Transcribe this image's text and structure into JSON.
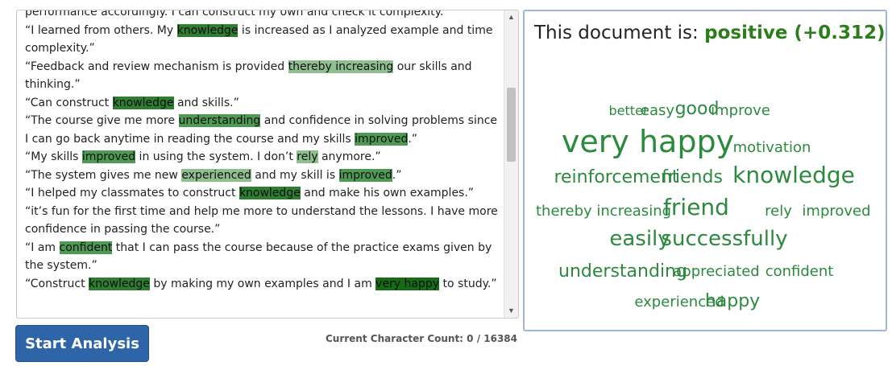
{
  "editor": {
    "lines": [
      [
        {
          "t": "performance accordingly. I can construct my own and check it complexity.”"
        }
      ],
      [
        {
          "t": "“I learned from others. My "
        },
        {
          "t": "knowledge",
          "h": "dark"
        },
        {
          "t": " is increased as I analyzed example and time complexity.”"
        }
      ],
      [
        {
          "t": "“Feedback and review mechanism is provided "
        },
        {
          "t": "thereby increasing",
          "h": "light"
        },
        {
          "t": " our skills and thinking.”"
        }
      ],
      [
        {
          "t": "“Can construct "
        },
        {
          "t": "knowledge",
          "h": "dark"
        },
        {
          "t": " and skills.”"
        }
      ],
      [
        {
          "t": "“The course give me more "
        },
        {
          "t": "understanding",
          "h": "mid"
        },
        {
          "t": " and confidence in solving problems since I can go back anytime in reading the course and my skills "
        },
        {
          "t": "improved",
          "h": "mid"
        },
        {
          "t": ".”"
        }
      ],
      [
        {
          "t": "“My skills "
        },
        {
          "t": "improved",
          "h": "mid"
        },
        {
          "t": " in using the system. I don’t "
        },
        {
          "t": "rely",
          "h": "light"
        },
        {
          "t": " anymore.”"
        }
      ],
      [
        {
          "t": "“The system gives me new "
        },
        {
          "t": "experienced",
          "h": "light"
        },
        {
          "t": " and my skill is "
        },
        {
          "t": "improved",
          "h": "mid"
        },
        {
          "t": ".”"
        }
      ],
      [
        {
          "t": "“I helped my classmates to construct "
        },
        {
          "t": "knowledge",
          "h": "dark"
        },
        {
          "t": " and make his own examples.”"
        }
      ],
      [
        {
          "t": "“it’s fun for the first time and help me more to understand the lessons. I have more confidence in passing the course.”"
        }
      ],
      [
        {
          "t": "“I am "
        },
        {
          "t": "confident",
          "h": "mid"
        },
        {
          "t": " that I can pass the course because of the practice exams given by the system.”"
        }
      ],
      [
        {
          "t": "“Construct "
        },
        {
          "t": "knowledge",
          "h": "dark"
        },
        {
          "t": " by making my own examples and I am "
        },
        {
          "t": "very happy",
          "h": "black"
        },
        {
          "t": " to study.”"
        }
      ]
    ]
  },
  "scrollbar": {
    "up_icon": "triangle-up-icon",
    "down_icon": "triangle-down-icon",
    "up_glyph": "▲",
    "down_glyph": "▼"
  },
  "actions": {
    "start_label": "Start Analysis"
  },
  "counter": {
    "text": "Current Character Count: 0 / 16384"
  },
  "result": {
    "prefix": "This document is: ",
    "sentiment": "positive (+0.312)"
  },
  "colors": {
    "highlight_dark": "#2e7d32",
    "highlight_mid": "#4e9a55",
    "highlight_light": "#8fbf8f",
    "word_cloud": "#2b8a3e",
    "button": "#2e64a8"
  },
  "word_cloud": [
    {
      "text": "better",
      "size": 16
    },
    {
      "text": "easy",
      "size": 18
    },
    {
      "text": "good",
      "size": 22
    },
    {
      "text": "improve",
      "size": 18
    },
    {
      "text": "very happy",
      "size": 38
    },
    {
      "text": "motivation",
      "size": 18
    },
    {
      "text": "reinforcement",
      "size": 22
    },
    {
      "text": "friends",
      "size": 22
    },
    {
      "text": "knowledge",
      "size": 28
    },
    {
      "text": "thereby increasing",
      "size": 18
    },
    {
      "text": "friend",
      "size": 28
    },
    {
      "text": "rely",
      "size": 18
    },
    {
      "text": "improved",
      "size": 18
    },
    {
      "text": "easily",
      "size": 26
    },
    {
      "text": "successfully",
      "size": 26
    },
    {
      "text": "understanding",
      "size": 22
    },
    {
      "text": "appreciated",
      "size": 18
    },
    {
      "text": "confident",
      "size": 18
    },
    {
      "text": "experienced",
      "size": 18
    },
    {
      "text": "happy",
      "size": 22
    }
  ]
}
